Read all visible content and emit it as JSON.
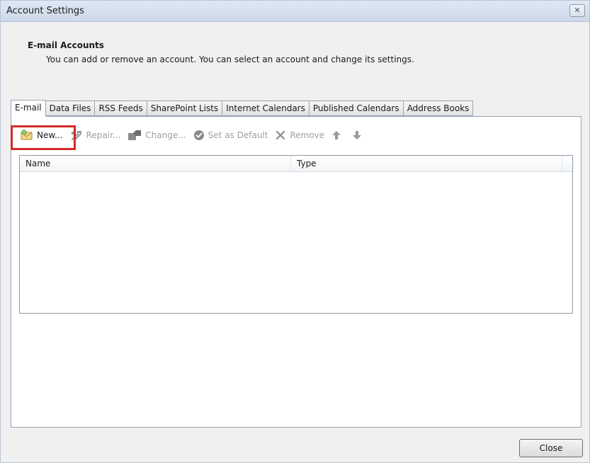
{
  "window": {
    "title": "Account Settings",
    "close_glyph": "✕"
  },
  "header": {
    "title": "E-mail Accounts",
    "description": "You can add or remove an account. You can select an account and change its settings."
  },
  "tabs": [
    {
      "label": "E-mail",
      "active": true
    },
    {
      "label": "Data Files",
      "active": false
    },
    {
      "label": "RSS Feeds",
      "active": false
    },
    {
      "label": "SharePoint Lists",
      "active": false
    },
    {
      "label": "Internet Calendars",
      "active": false
    },
    {
      "label": "Published Calendars",
      "active": false
    },
    {
      "label": "Address Books",
      "active": false
    }
  ],
  "toolbar": {
    "new_label": "New...",
    "repair_label": "Repair...",
    "change_label": "Change...",
    "set_default_label": "Set as Default",
    "remove_label": "Remove",
    "icons": {
      "new": "new-account-envelope-icon",
      "repair": "repair-tools-icon",
      "change": "change-account-icon",
      "set_default": "check-circle-icon",
      "remove": "remove-x-icon",
      "move_up": "arrow-up-icon",
      "move_down": "arrow-down-icon"
    }
  },
  "accounts_list": {
    "columns": [
      "Name",
      "Type"
    ],
    "rows": []
  },
  "footer": {
    "close_label": "Close"
  },
  "colors": {
    "highlight": "#d42a2a",
    "titlebar": "#cdd9e9",
    "dialog_bg": "#f0f0f0"
  }
}
